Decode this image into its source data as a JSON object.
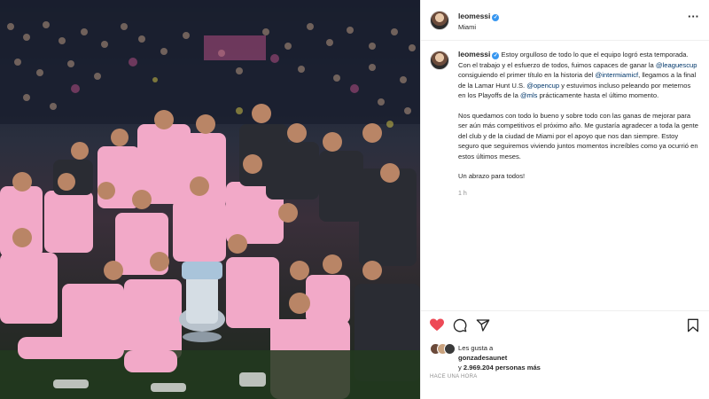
{
  "header": {
    "username": "leomessi",
    "location": "Miami",
    "more_icon": "more-horizontal-icon"
  },
  "caption": {
    "username": "leomessi",
    "p1_a": "Estoy orgulloso de todo lo que el equipo logró esta temporada. Con el trabajo y el esfuerzo de todos, fuimos capaces de ganar la ",
    "tag_leaguescup": "@leaguescup",
    "p1_b": " consiguiendo el primer título en la historia del ",
    "tag_intermiamicf": "@intermiamicf",
    "p1_c": ", llegamos a la final de la Lamar Hunt U.S. ",
    "tag_opencup": "@opencup",
    "p1_d": " y estuvimos incluso peleando por meternos en los Playoffs de la ",
    "tag_mls": "@mls",
    "p1_e": " prácticamente hasta el último momento.",
    "p2": "Nos quedamos con todo lo bueno y sobre todo con las ganas de mejorar para ser aún más competitivos el próximo año. Me gustaría agradecer a toda la gente del club y de la ciudad de Miami por el apoyo que nos dan siempre. Estoy seguro que seguiremos viviendo juntos momentos increíbles como ya ocurrió en estos últimos meses.",
    "p3": "Un abrazo para todos!",
    "time": "1 h"
  },
  "actions": {
    "like_icon": "heart-filled-icon",
    "comment_icon": "comment-icon",
    "share_icon": "send-icon",
    "save_icon": "bookmark-icon",
    "like_color": "#ed4956"
  },
  "likes": {
    "line1_prefix": "Les gusta a",
    "liker": "gonzadesaunet",
    "line2_prefix": "y ",
    "count": "2.969.204",
    "line2_suffix": " personas más"
  },
  "timestamp": "HACE UNA HORA"
}
